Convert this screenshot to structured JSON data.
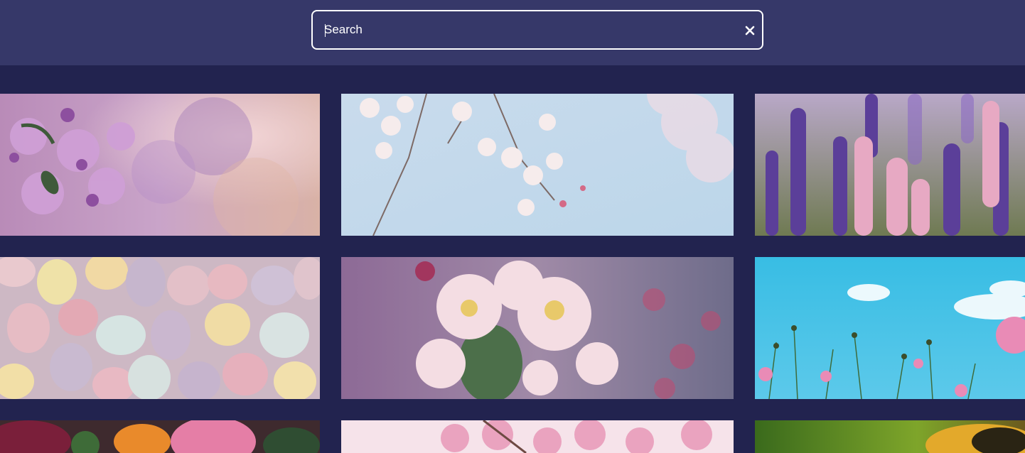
{
  "search": {
    "placeholder": "Search",
    "value": ""
  },
  "icons": {
    "clear": "close-icon"
  },
  "colors": {
    "header_bg": "#363869",
    "page_bg": "#22234f",
    "search_border": "#ffffff"
  },
  "gallery": {
    "tiles": [
      {
        "subject": "purple-apple-blossom"
      },
      {
        "subject": "cherry-blossom-sky"
      },
      {
        "subject": "lupine-field"
      },
      {
        "subject": "pastel-candy-eggs"
      },
      {
        "subject": "pink-apple-blossom"
      },
      {
        "subject": "cosmos-blue-sky"
      },
      {
        "subject": "pink-tulips"
      },
      {
        "subject": "pink-blossom-branch"
      },
      {
        "subject": "bumblebee"
      }
    ]
  }
}
